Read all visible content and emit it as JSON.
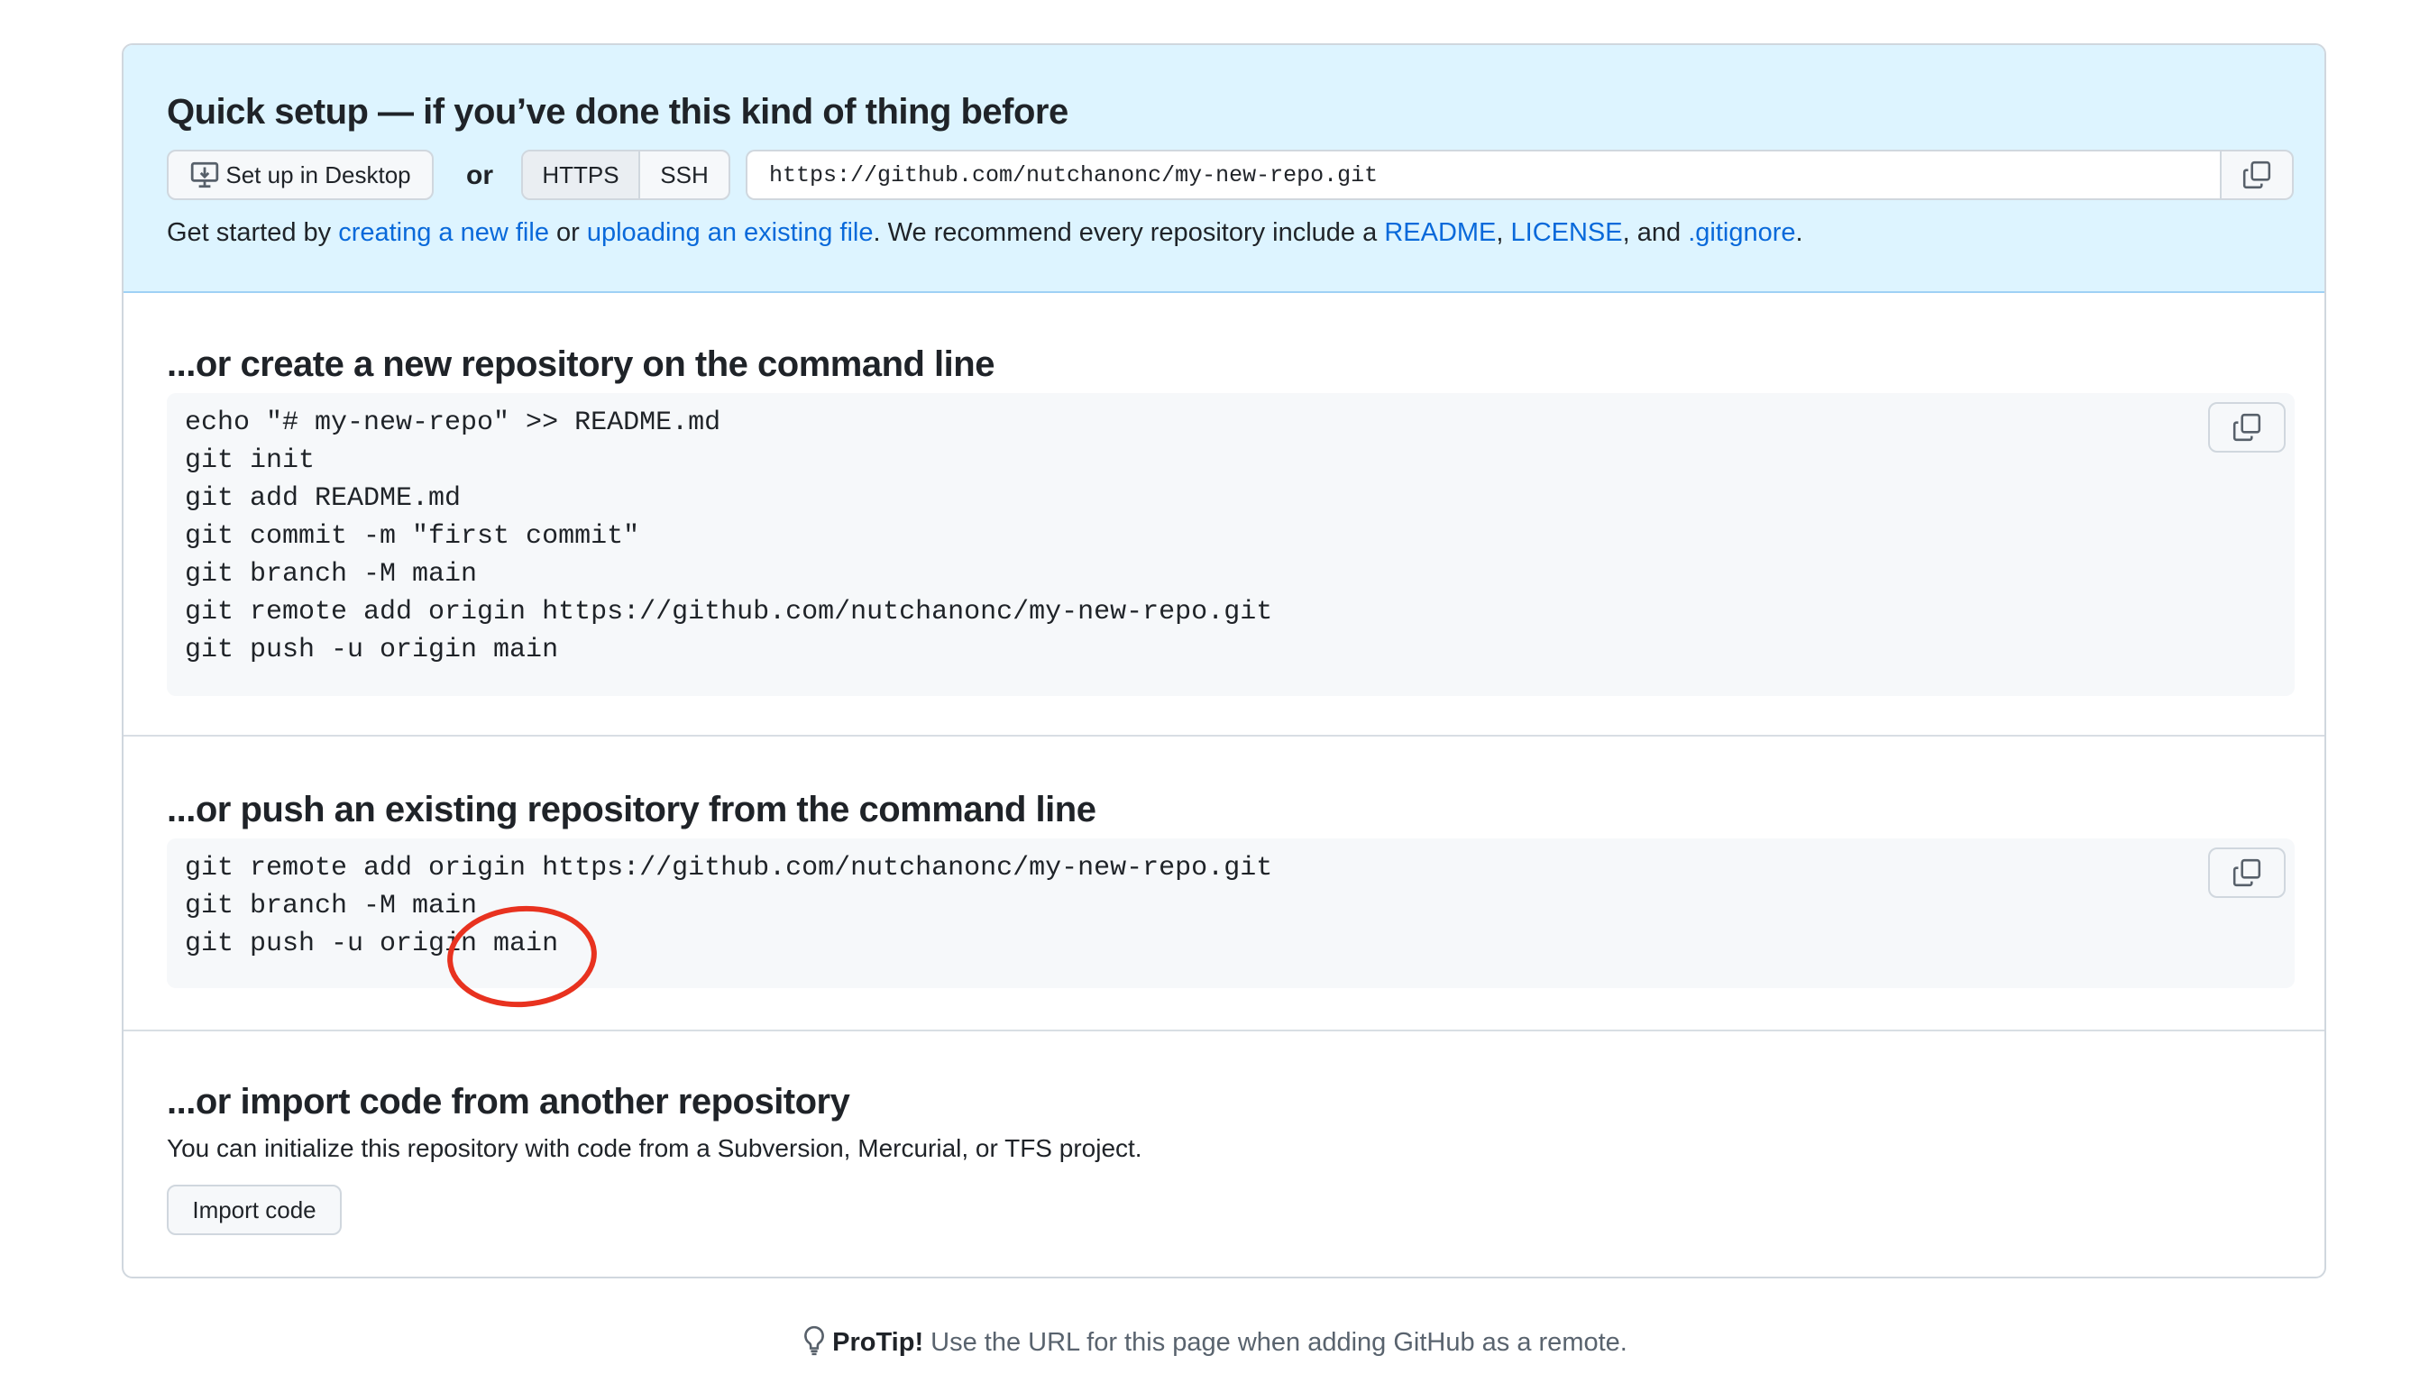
{
  "quick_setup": {
    "title": "Quick setup — if you’ve done this kind of thing before",
    "desktop_button": "Set up in Desktop",
    "or_label": "or",
    "protocols": [
      "HTTPS",
      "SSH"
    ],
    "selected_protocol": "HTTPS",
    "clone_url": "https://github.com/nutchanonc/my-new-repo.git",
    "intro": {
      "prefix": "Get started by ",
      "link_new_file": "creating a new file",
      "mid1": " or ",
      "link_upload": "uploading an existing file",
      "mid2": ". We recommend every repository include a ",
      "link_readme": "README",
      "comma1": ", ",
      "link_license": "LICENSE",
      "mid3": ", and ",
      "link_gitignore": ".gitignore",
      "suffix": "."
    }
  },
  "create_section": {
    "title": "...or create a new repository on the command line",
    "lines": [
      "echo \"# my-new-repo\" >> README.md",
      "git init",
      "git add README.md",
      "git commit -m \"first commit\"",
      "git branch -M main",
      "git remote add origin https://github.com/nutchanonc/my-new-repo.git",
      "git push -u origin main"
    ]
  },
  "push_section": {
    "title": "...or push an existing repository from the command line",
    "lines": [
      "git remote add origin https://github.com/nutchanonc/my-new-repo.git",
      "git branch -M main",
      "git push -u origin main"
    ]
  },
  "import_section": {
    "title": "...or import code from another repository",
    "description": "You can initialize this repository with code from a Subversion, Mercurial, or TFS project.",
    "button": "Import code"
  },
  "protip": {
    "label": "ProTip!",
    "text": " Use the URL for this page when adding GitHub as a remote."
  },
  "icons": {
    "desktop": "desktop-download-icon",
    "copy": "copy-icon",
    "protip": "light-bulb-icon"
  },
  "colors": {
    "link": "#0969da",
    "quick_setup_bg": "#ddf4ff",
    "annotation": "#e8321f"
  }
}
